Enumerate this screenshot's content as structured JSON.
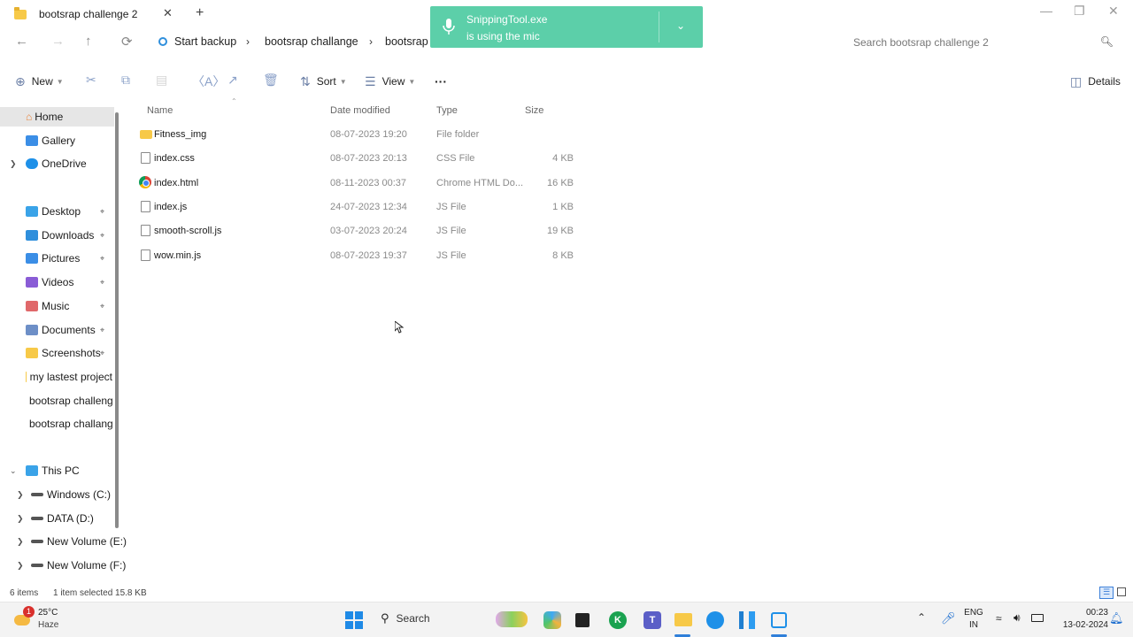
{
  "window": {
    "tab_title": "bootsrap challenge 2",
    "tab_close": "✕",
    "new_tab": "+",
    "minimize": "—",
    "maximize": "❐",
    "close": "✕"
  },
  "nav": {
    "back": "←",
    "forward": "→",
    "up": "↑",
    "refresh": "⟳",
    "breadcrumbs": [
      "Start backup",
      "bootsrap challange",
      "bootsrap challange 2"
    ],
    "separator": "›",
    "search_placeholder": "Search bootsrap challenge 2"
  },
  "notification": {
    "line1": "SnippingTool.exe",
    "line2": "is using the mic",
    "accent": "#5ccfa9"
  },
  "toolbar": {
    "new_label": "New",
    "sort_label": "Sort",
    "view_label": "View",
    "more_label": "···",
    "details_label": "Details",
    "icons": [
      "cut-icon",
      "copy-icon",
      "paste-icon",
      "rename-icon",
      "share-icon",
      "delete-icon"
    ]
  },
  "sidebar": {
    "home": "Home",
    "gallery": "Gallery",
    "onedrive": "OneDrive",
    "quick": [
      {
        "label": "Desktop",
        "color": "#3aa3e8"
      },
      {
        "label": "Downloads",
        "color": "#2f8fdc"
      },
      {
        "label": "Pictures",
        "color": "#3b8ee6"
      },
      {
        "label": "Videos",
        "color": "#8a5cd6"
      },
      {
        "label": "Music",
        "color": "#e0686a"
      },
      {
        "label": "Documents",
        "color": "#6d8fc7"
      },
      {
        "label": "Screenshots",
        "color": "#f7c948"
      },
      {
        "label": "my lastest project",
        "color": "#f7c948"
      },
      {
        "label": "bootsrap challeng",
        "color": "#f7c948"
      },
      {
        "label": "bootsrap challang",
        "color": "#f7c948"
      }
    ],
    "this_pc": "This PC",
    "drives": [
      "Windows (C:)",
      "DATA (D:)",
      "New Volume (E:)",
      "New Volume (F:)"
    ]
  },
  "columns": {
    "name": "Name",
    "date": "Date modified",
    "type": "Type",
    "size": "Size"
  },
  "files": [
    {
      "name": "Fitness_img",
      "date": "08-07-2023 19:20",
      "type": "File folder",
      "size": "",
      "kind": "folder"
    },
    {
      "name": "index.css",
      "date": "08-07-2023 20:13",
      "type": "CSS File",
      "size": "4 KB",
      "kind": "file"
    },
    {
      "name": "index.html",
      "date": "08-11-2023 00:37",
      "type": "Chrome HTML Do...",
      "size": "16 KB",
      "kind": "chrome"
    },
    {
      "name": "index.js",
      "date": "24-07-2023 12:34",
      "type": "JS File",
      "size": "1 KB",
      "kind": "file"
    },
    {
      "name": "smooth-scroll.js",
      "date": "03-07-2023 20:24",
      "type": "JS File",
      "size": "19 KB",
      "kind": "file"
    },
    {
      "name": "wow.min.js",
      "date": "08-07-2023 19:37",
      "type": "JS File",
      "size": "8 KB",
      "kind": "file"
    }
  ],
  "status": {
    "count": "6 items",
    "selected": "1 item selected  15.8 KB"
  },
  "taskbar": {
    "weather_temp": "25°C",
    "weather_desc": "Haze",
    "weather_badge": "1",
    "search_label": "Search",
    "lang1": "ENG",
    "lang2": "IN",
    "time": "00:23",
    "date": "13-02-2024"
  }
}
